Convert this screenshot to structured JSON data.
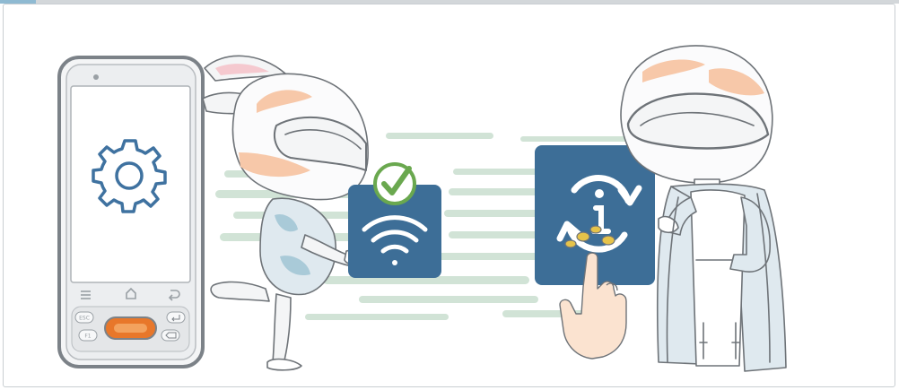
{
  "colors": {
    "frame_border": "#c9ced2",
    "accent_top": "#8fbad2",
    "tile_blue": "#3d6e97",
    "gear_blue": "#3f72a0",
    "check_green": "#6aa84f",
    "stripe_green": "#c9dfcf",
    "device_gray": "#7c8288",
    "orange_key": "#e8772a"
  },
  "device": {
    "screen_icon": "gear-icon",
    "nav_icons": [
      "menu-icon",
      "home-icon",
      "back-icon"
    ],
    "keys": {
      "esc": "ESC",
      "fn": "F1",
      "enter_icon": "enter-icon",
      "delete_icon": "delete-icon"
    }
  },
  "tiles": {
    "wifi_tile_icon": "wifi-icon",
    "check_icon": "checkmark-icon",
    "update_tile_icon": "info-sync-icon",
    "pointer_icon": "pointing-hand-icon"
  },
  "characters": [
    "bunny-helmet-character",
    "helmet-character"
  ]
}
